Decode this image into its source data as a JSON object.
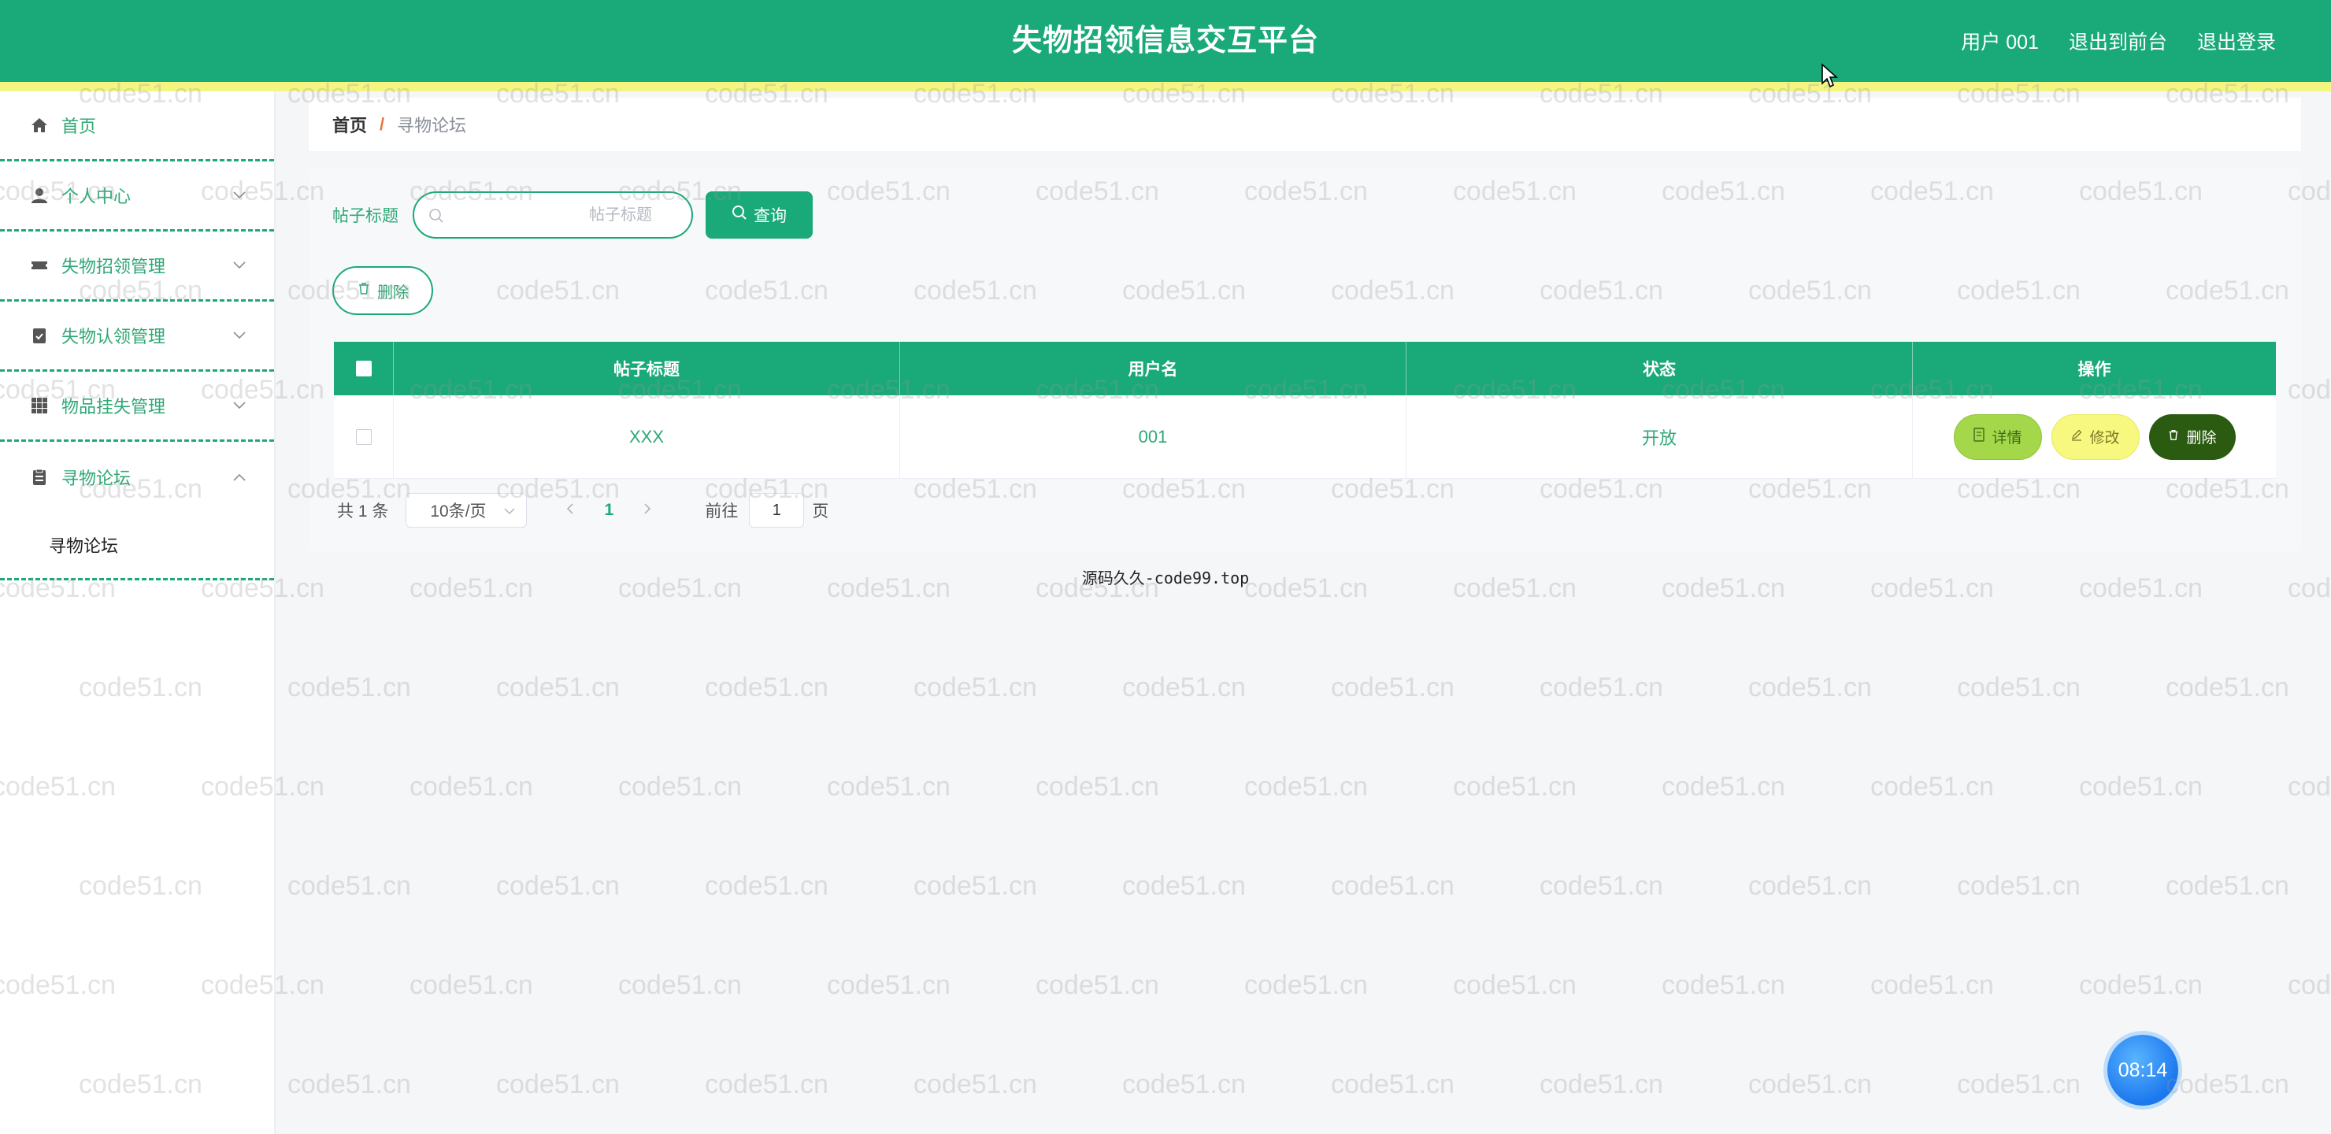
{
  "header": {
    "title": "失物招领信息交互平台",
    "user_label": "用户 001",
    "to_front": "退出到前台",
    "logout": "退出登录"
  },
  "sidebar": {
    "items": [
      {
        "label": "首页",
        "icon": "home-icon"
      },
      {
        "label": "个人中心",
        "icon": "user-icon"
      },
      {
        "label": "失物招领管理",
        "icon": "ticket-icon"
      },
      {
        "label": "失物认领管理",
        "icon": "clipboard-check-icon"
      },
      {
        "label": "物品挂失管理",
        "icon": "grid-icon"
      },
      {
        "label": "寻物论坛",
        "icon": "document-icon"
      }
    ],
    "sub_items": [
      {
        "label": "寻物论坛"
      }
    ]
  },
  "breadcrumb": {
    "home": "首页",
    "separator": "/",
    "current": "寻物论坛"
  },
  "search": {
    "label": "帖子标题",
    "placeholder": "帖子标题",
    "query_button": "查询"
  },
  "toolbar": {
    "delete_button": "删除"
  },
  "table": {
    "columns": [
      "帖子标题",
      "用户名",
      "状态",
      "操作"
    ],
    "rows": [
      {
        "title": "XXX",
        "username": "001",
        "status": "开放"
      }
    ],
    "actions": {
      "detail": "详情",
      "edit": "修改",
      "delete": "删除"
    }
  },
  "pagination": {
    "total": "共 1 条",
    "page_size": "10条/页",
    "current_page": "1",
    "goto_label": "前往",
    "goto_value": "1",
    "page_suffix": "页"
  },
  "footer": {
    "note": "源码久久-code99.top"
  },
  "clock": {
    "time": "08:14"
  },
  "watermark": {
    "text": "code51.cn"
  },
  "colors": {
    "primary": "#1aa979",
    "strip": "#f4f681",
    "detail_button": "#a4d84a",
    "edit_button": "#f7f87f",
    "delete_button": "#2b5a11"
  }
}
